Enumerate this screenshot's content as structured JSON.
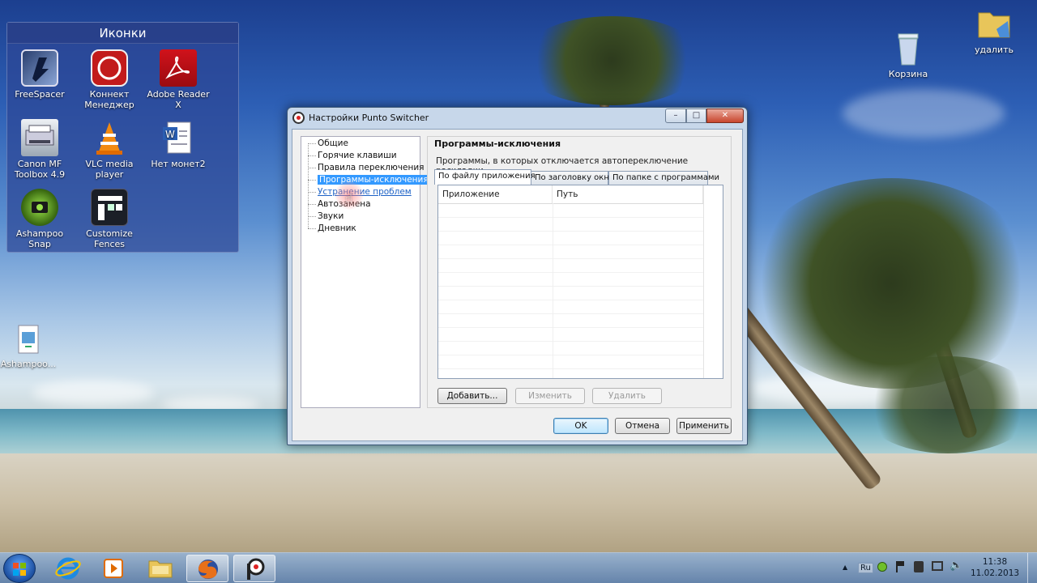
{
  "desktop": {
    "fence": {
      "title": "Иконки",
      "icons": [
        {
          "label": "FreeSpacer",
          "icon": "freespacer-icon"
        },
        {
          "label": "Коннект Менеджер",
          "icon": "connect-manager-icon"
        },
        {
          "label": "Adobe Reader X",
          "icon": "adobe-reader-icon"
        },
        {
          "label": "Canon MF Toolbox 4.9",
          "icon": "canon-toolbox-icon"
        },
        {
          "label": "VLC media player",
          "icon": "vlc-icon"
        },
        {
          "label": "Нет монет2",
          "icon": "word-document-icon"
        },
        {
          "label": "Ashampoo Snap",
          "icon": "ashampoo-snap-icon"
        },
        {
          "label": "Customize Fences",
          "icon": "fences-icon"
        }
      ]
    },
    "loose_icons": [
      {
        "label": "Ashampoo...",
        "icon": "media-file-icon"
      },
      {
        "label": "Корзина",
        "icon": "recycle-bin-icon"
      },
      {
        "label": "удалить",
        "icon": "folder-icon"
      }
    ]
  },
  "window": {
    "title": "Настройки Punto Switcher",
    "caption_buttons": {
      "minimize": "–",
      "maximize": "□",
      "close": "✕"
    },
    "tree": [
      {
        "label": "Общие",
        "state": "normal"
      },
      {
        "label": "Горячие клавиши",
        "state": "normal"
      },
      {
        "label": "Правила переключения",
        "state": "normal"
      },
      {
        "label": "Программы-исключения",
        "state": "selected"
      },
      {
        "label": "Устранение проблем",
        "state": "hover"
      },
      {
        "label": "Автозамена",
        "state": "normal"
      },
      {
        "label": "Звуки",
        "state": "normal"
      },
      {
        "label": "Дневник",
        "state": "normal"
      }
    ],
    "panel": {
      "title": "Программы-исключения",
      "description": "Программы, в которых отключается автопереключение раскладки.",
      "tabs": [
        {
          "label": "По файлу приложения",
          "active": true
        },
        {
          "label": "По заголовку окна",
          "active": false
        },
        {
          "label": "По папке с программами",
          "active": false
        }
      ],
      "columns": [
        "Приложение",
        "Путь"
      ],
      "rows": [],
      "buttons": {
        "add": "Добавить...",
        "edit": "Изменить",
        "delete": "Удалить"
      }
    },
    "footer": {
      "ok": "OK",
      "cancel": "Отмена",
      "apply": "Применить"
    }
  },
  "taskbar": {
    "pinned": [
      "internet-explorer-icon",
      "media-player-icon",
      "explorer-folder-icon",
      "firefox-icon",
      "punto-switcher-icon"
    ],
    "active_index": 4,
    "tray": {
      "language": "Ru",
      "expand": "▲"
    },
    "clock": {
      "time": "11:38",
      "date": "11.02.2013"
    }
  },
  "colors": {
    "selection": "#3399ff",
    "link": "#1f63c6",
    "fence_bg": "#2d4696"
  }
}
